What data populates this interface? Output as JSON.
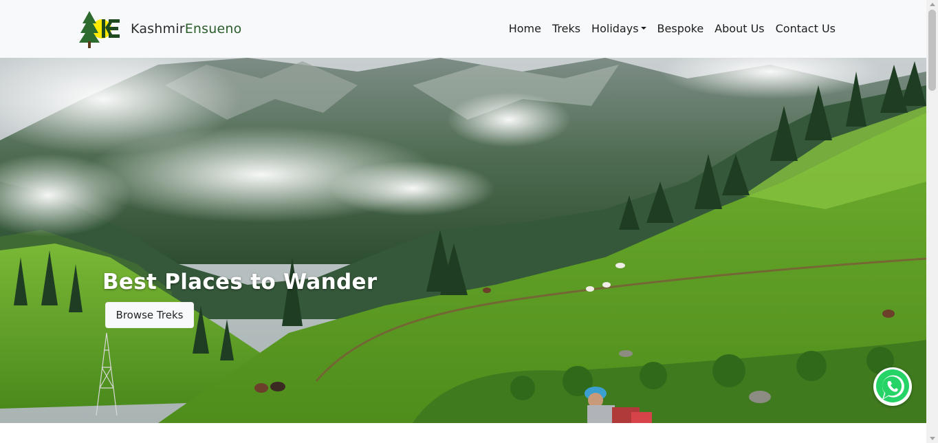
{
  "brand": {
    "name_part1": "Kashmir",
    "name_part2": "Ensueno",
    "logo_icon": "pine-tree-ke-logo-icon"
  },
  "nav": {
    "items": [
      {
        "label": "Home"
      },
      {
        "label": "Treks"
      },
      {
        "label": "Holidays",
        "has_dropdown": true
      },
      {
        "label": "Bespoke"
      },
      {
        "label": "About Us"
      },
      {
        "label": "Contact Us"
      }
    ]
  },
  "hero": {
    "title": "Best Places to Wander",
    "button_label": "Browse Treks",
    "image": "mountain-meadow-landscape"
  },
  "whatsapp": {
    "icon": "whatsapp-icon",
    "color": "#25d366"
  },
  "colors": {
    "navbar_bg": "#f8f9fa",
    "brand_green": "#2a5d2a",
    "logo_yellow": "#ffea00"
  }
}
